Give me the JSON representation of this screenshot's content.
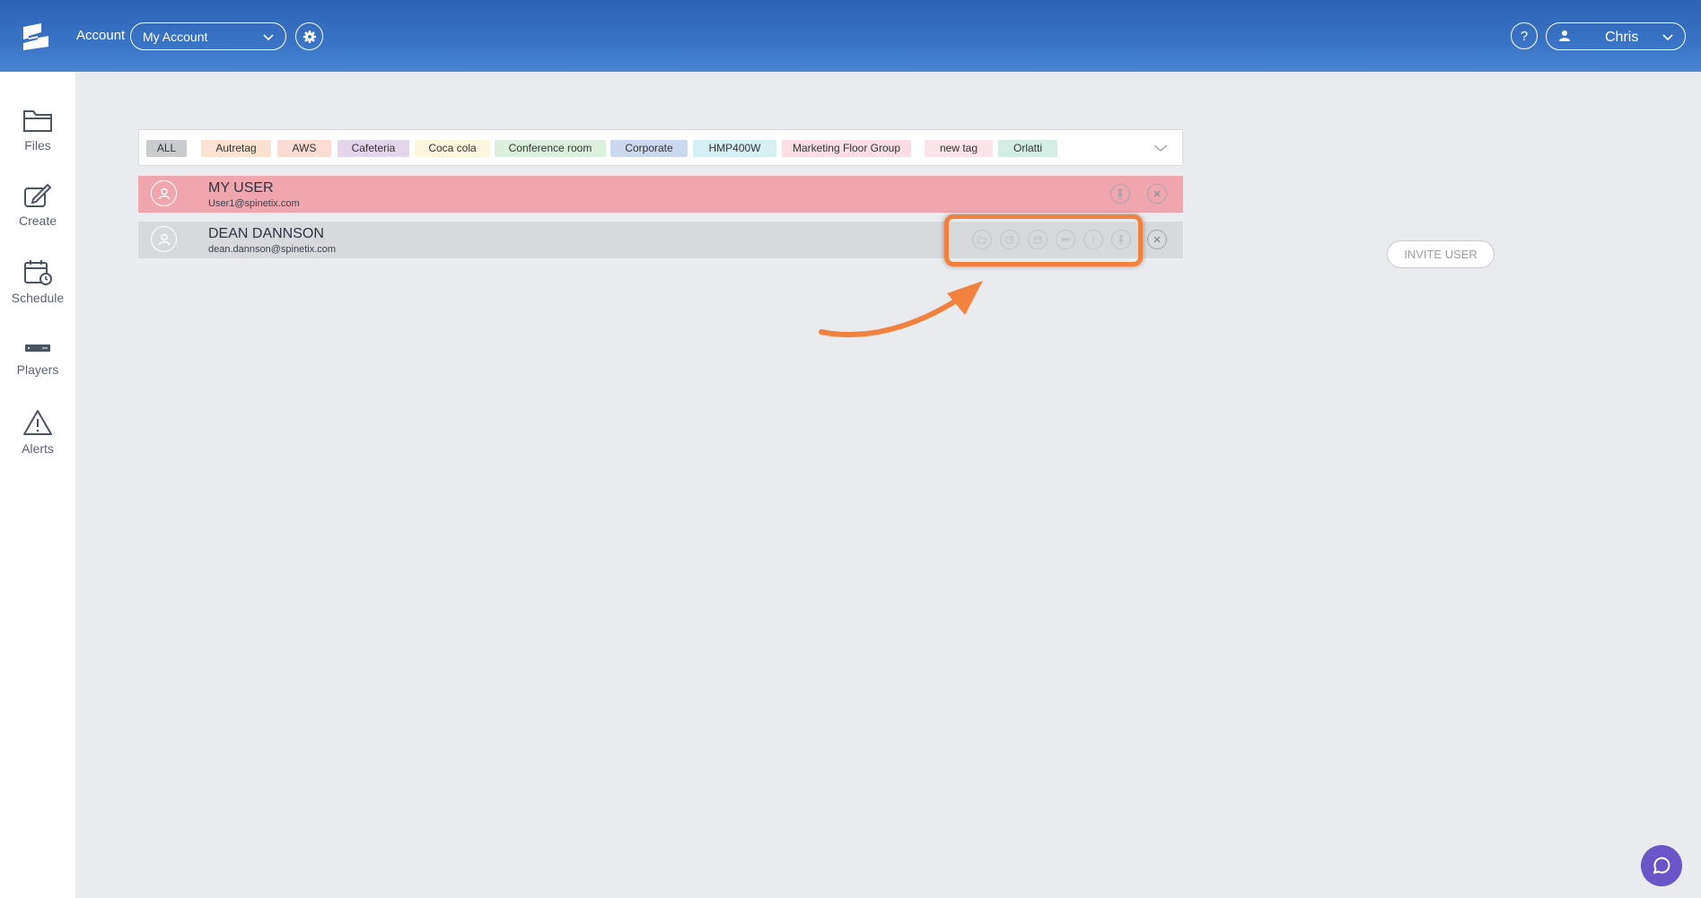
{
  "header": {
    "account_label": "Account",
    "account_value": "My Account",
    "help_label": "?",
    "user_name": "Chris"
  },
  "sidebar": {
    "items": [
      {
        "label": "Files",
        "icon": "folder-icon"
      },
      {
        "label": "Create",
        "icon": "create-icon"
      },
      {
        "label": "Schedule",
        "icon": "calendar-icon"
      },
      {
        "label": "Players",
        "icon": "player-icon"
      },
      {
        "label": "Alerts",
        "icon": "alert-icon"
      }
    ]
  },
  "tags": [
    {
      "label": "ALL",
      "color": "#c9cbcf"
    },
    {
      "label": "Autretag",
      "color": "#fbe2d2"
    },
    {
      "label": "AWS",
      "color": "#fbdcd5"
    },
    {
      "label": "Cafeteria",
      "color": "#e3d6ea"
    },
    {
      "label": "Coca cola",
      "color": "#fdf6df"
    },
    {
      "label": "Conference room",
      "color": "#dcefdc"
    },
    {
      "label": "Corporate",
      "color": "#cbd8ee"
    },
    {
      "label": "HMP400W",
      "color": "#d6eff2"
    },
    {
      "label": "Marketing Floor Group",
      "color": "#fbdde6"
    },
    {
      "label": "new tag",
      "color": "#fbe3ea"
    },
    {
      "label": "Orlatti",
      "color": "#d3ede5"
    }
  ],
  "users": [
    {
      "name": "MY USER",
      "email": "User1@spinetix.com"
    },
    {
      "name": "DEAN DANNSON",
      "email": "dean.dannson@spinetix.com"
    }
  ],
  "invite_label": "INVITE USER",
  "colors": {
    "header_blue": "#3a73c6",
    "my_user_row": "#efa6ae",
    "other_user_row": "#d8d9dc",
    "highlight_orange": "#f2803f",
    "chat_purple": "#6a56c8"
  }
}
